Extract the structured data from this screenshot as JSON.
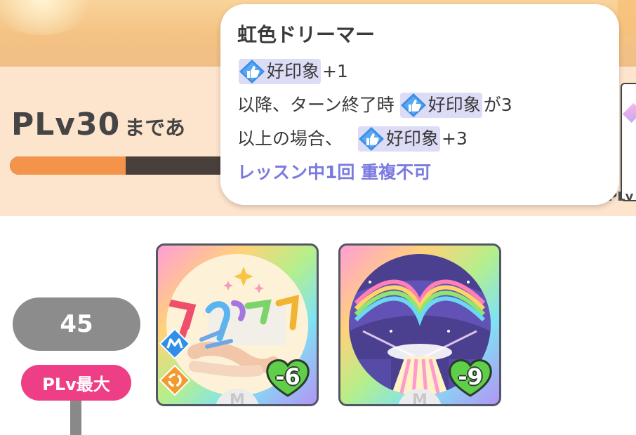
{
  "header": {
    "plv_label": "PLv30",
    "plv_suffix": "まであ",
    "progress_fraction": 0.5,
    "side_card_label": "PLv"
  },
  "tooltip": {
    "title": "虹色ドリーマー",
    "keyword": "好印象",
    "line1_suffix": "+1",
    "line2_prefix": "以降、ターン終了時",
    "line2_suffix": "が3",
    "line3_prefix": "以上の場合、",
    "line3_suffix": "+3",
    "line4": "レッスン中1回 重複不可"
  },
  "level_panel": {
    "level": "45",
    "plv_max_badge": "PLv最大"
  },
  "cards": [
    {
      "cost": "-6",
      "grade": "M",
      "icons": [
        "mental-type-icon",
        "orange-cycle-icon"
      ]
    },
    {
      "cost": "-9",
      "grade": "M",
      "icons": []
    }
  ],
  "colors": {
    "accent_orange": "#f4934a",
    "progress_track": "#4a403b",
    "keyword_highlight": "#dcdcf7",
    "blue_text": "#7b7ae0",
    "plv_max_pink": "#ee3f86",
    "level_pill_gray": "#8c8c8c"
  }
}
